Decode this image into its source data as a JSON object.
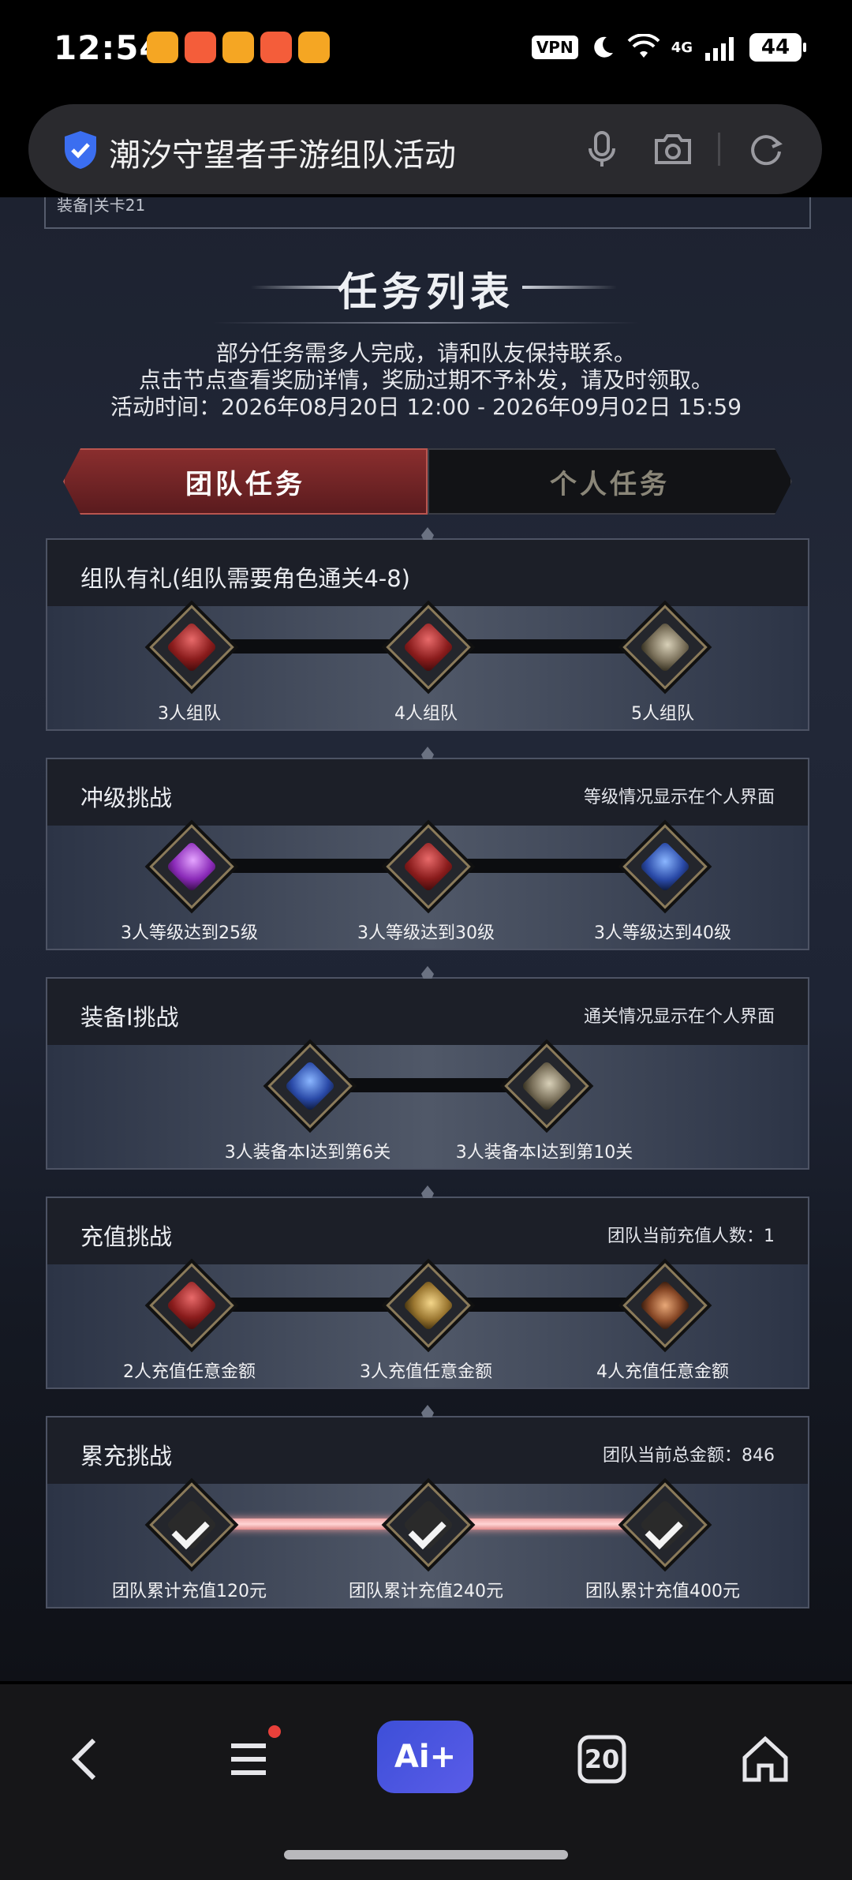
{
  "status_bar": {
    "time": "12:54",
    "vpn": "VPN",
    "network": "4G",
    "battery": "44",
    "notification_icons": [
      "weibo-icon",
      "flower-app-icon",
      "weibo-icon",
      "flower-app-icon",
      "weibo-icon"
    ]
  },
  "search_bar": {
    "text": "潮汐守望者手游组队活动"
  },
  "previous_section": {
    "text": "装备|关卡21"
  },
  "header": {
    "title": "任务列表",
    "desc_line1": "部分任务需多人完成，请和队友保持联系。",
    "desc_line2": "点击节点查看奖励详情，奖励过期不予补发，请及时领取。",
    "desc_line3": "活动时间：2026年08月20日 12:00 - 2026年09月02日 15:59"
  },
  "tabs": {
    "team": "团队任务",
    "personal": "个人任务",
    "active": "team"
  },
  "panels": [
    {
      "title": "组队有礼(组队需要角色通关4-8)",
      "note": "",
      "nodes": [
        {
          "label": "3人组队",
          "icon": "red-gem-icon"
        },
        {
          "label": "4人组队",
          "icon": "red-gem-icon"
        },
        {
          "label": "5人组队",
          "icon": "armor-icon"
        }
      ]
    },
    {
      "title": "冲级挑战",
      "note": "等级情况显示在个人界面",
      "nodes": [
        {
          "label": "3人等级达到25级",
          "icon": "purple-crystal-icon"
        },
        {
          "label": "3人等级达到30级",
          "icon": "red-gem-icon"
        },
        {
          "label": "3人等级达到40级",
          "icon": "blue-orb-icon"
        }
      ]
    },
    {
      "title": "装备Ⅰ挑战",
      "note": "通关情况显示在个人界面",
      "nodes": [
        {
          "label": "3人装备本Ⅰ达到第6关",
          "icon": "blue-orb-icon"
        },
        {
          "label": "3人装备本Ⅰ达到第10关",
          "icon": "armor-chest-icon"
        }
      ]
    },
    {
      "title": "充值挑战",
      "note": "团队当前充值人数：1",
      "nodes": [
        {
          "label": "2人充值任意金额",
          "icon": "red-gem-icon"
        },
        {
          "label": "3人充值任意金额",
          "icon": "gold-relic-icon"
        },
        {
          "label": "4人充值任意金额",
          "icon": "bread-icon"
        }
      ]
    },
    {
      "title": "累充挑战",
      "note": "团队当前总金额：846",
      "nodes": [
        {
          "label": "团队累计充值120元",
          "icon": "checkmark-icon"
        },
        {
          "label": "团队累计充值240元",
          "icon": "checkmark-icon"
        },
        {
          "label": "团队累计充值400元",
          "icon": "checkmark-icon"
        }
      ]
    }
  ],
  "bottom_nav": {
    "ai_label": "Ai+",
    "tabs_count": "20"
  }
}
